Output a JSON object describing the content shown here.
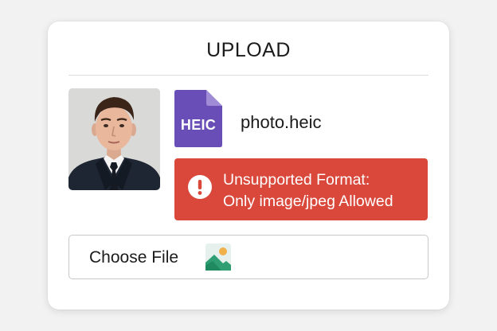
{
  "dialog": {
    "title": "UPLOAD"
  },
  "file": {
    "extension_badge": "HEIC",
    "name": "photo.heic",
    "thumbnail": "portrait-photo"
  },
  "error": {
    "line1": "Unsupported Format:",
    "line2": "Only image/jpeg Allowed",
    "icon": "exclamation-circle-icon"
  },
  "choose_file": {
    "label": "Choose File",
    "icon": "image-icon"
  },
  "colors": {
    "error_bg": "#d9483b",
    "file_icon": "#6a4eb8",
    "card_bg": "#ffffff"
  }
}
